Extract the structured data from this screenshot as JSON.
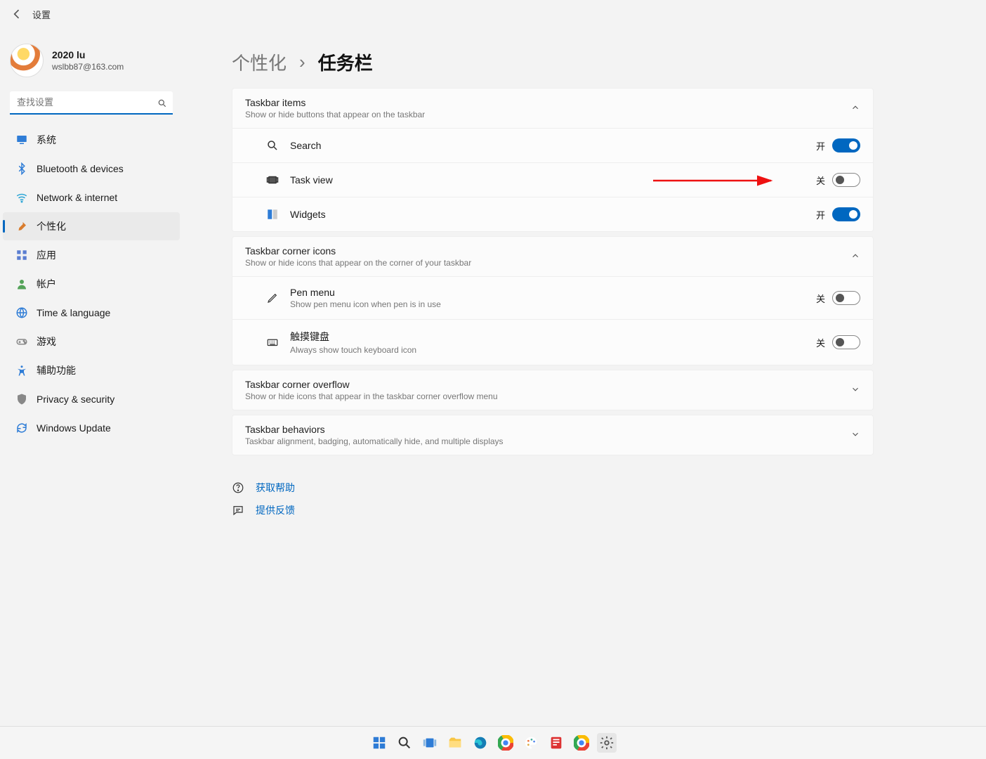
{
  "top": {
    "back_title": "设置"
  },
  "user": {
    "name": "2020 lu",
    "email": "wslbb87@163.com"
  },
  "search": {
    "placeholder": "查找设置"
  },
  "nav": [
    {
      "label": "系统",
      "icon": "monitor",
      "color": "#2e7cd6"
    },
    {
      "label": "Bluetooth & devices",
      "icon": "bluetooth",
      "color": "#2e7cd6"
    },
    {
      "label": "Network & internet",
      "icon": "wifi",
      "color": "#2ea6d6"
    },
    {
      "label": "个性化",
      "icon": "brush",
      "color": "#d97d2e",
      "selected": true
    },
    {
      "label": "应用",
      "icon": "apps",
      "color": "#5b7ed1"
    },
    {
      "label": "帐户",
      "icon": "person",
      "color": "#55a35a"
    },
    {
      "label": "Time & language",
      "icon": "globe",
      "color": "#2e7cd6"
    },
    {
      "label": "游戏",
      "icon": "gamepad",
      "color": "#888"
    },
    {
      "label": "辅助功能",
      "icon": "accessibility",
      "color": "#2e7cd6"
    },
    {
      "label": "Privacy & security",
      "icon": "shield",
      "color": "#888"
    },
    {
      "label": "Windows Update",
      "icon": "update",
      "color": "#2e7cd6"
    }
  ],
  "breadcrumb": {
    "parent": "个性化",
    "sep": "›",
    "current": "任务栏"
  },
  "state_labels": {
    "on": "开",
    "off": "关"
  },
  "sections": [
    {
      "id": "taskbar-items",
      "title": "Taskbar items",
      "desc": "Show or hide buttons that appear on the taskbar",
      "expanded": true,
      "rows": [
        {
          "icon": "search",
          "label": "Search",
          "state": "on"
        },
        {
          "icon": "taskview",
          "label": "Task view",
          "state": "off",
          "highlight": true
        },
        {
          "icon": "widgets",
          "label": "Widgets",
          "state": "on"
        }
      ]
    },
    {
      "id": "corner-icons",
      "title": "Taskbar corner icons",
      "desc": "Show or hide icons that appear on the corner of your taskbar",
      "expanded": true,
      "rows": [
        {
          "icon": "pen",
          "label": "Pen menu",
          "sub": "Show pen menu icon when pen is in use",
          "state": "off"
        },
        {
          "icon": "keyboard",
          "label": "触摸键盘",
          "sub": "Always show touch keyboard icon",
          "state": "off"
        }
      ]
    },
    {
      "id": "corner-overflow",
      "title": "Taskbar corner overflow",
      "desc": "Show or hide icons that appear in the taskbar corner overflow menu",
      "expanded": false
    },
    {
      "id": "behaviors",
      "title": "Taskbar behaviors",
      "desc": "Taskbar alignment, badging, automatically hide, and multiple displays",
      "expanded": false
    }
  ],
  "links": [
    {
      "icon": "help",
      "label": "获取帮助"
    },
    {
      "icon": "feedback",
      "label": "提供反馈"
    }
  ],
  "taskbar_apps": [
    "start",
    "search",
    "taskview",
    "explorer",
    "edge",
    "chrome",
    "paint",
    "office",
    "chrome2",
    "settings"
  ]
}
